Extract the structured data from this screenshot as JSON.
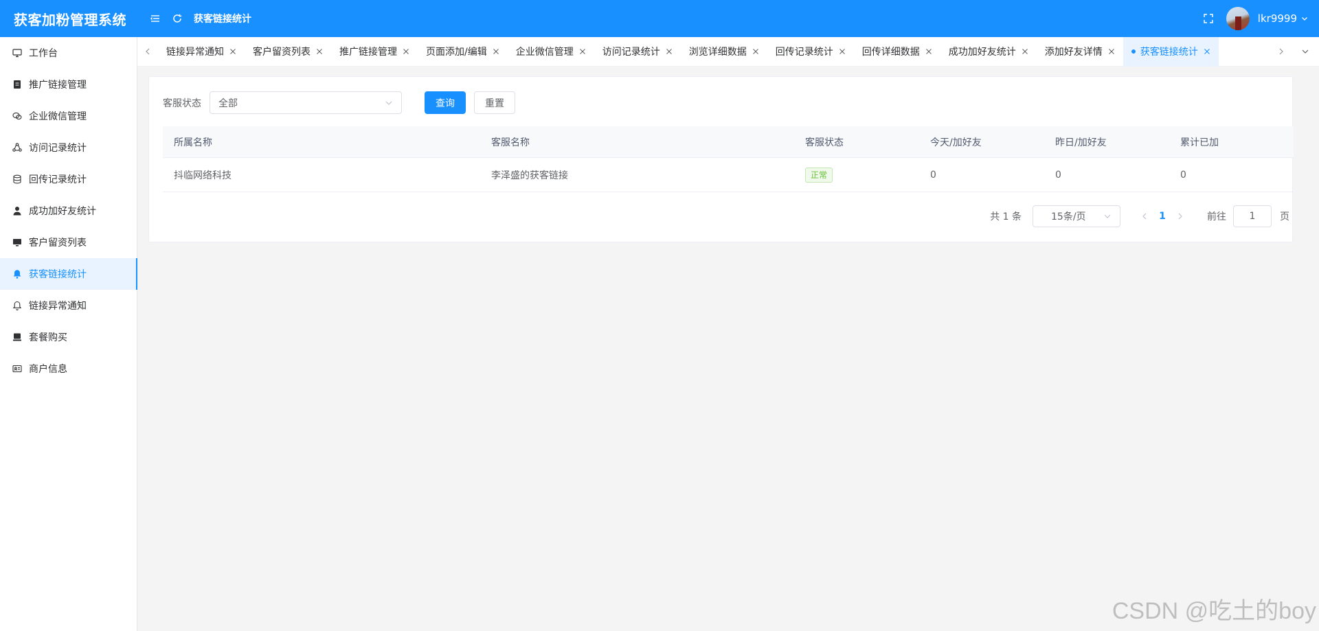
{
  "header": {
    "title": "获客加粉管理系统",
    "breadcrumb": "获客链接统计",
    "username": "lkr9999",
    "color": "#1890ff"
  },
  "sidebar": {
    "items": [
      {
        "label": "工作台",
        "icon": "monitor-icon"
      },
      {
        "label": "推广链接管理",
        "icon": "document-icon"
      },
      {
        "label": "企业微信管理",
        "icon": "wechat-icon"
      },
      {
        "label": "访问记录统计",
        "icon": "cluster-icon"
      },
      {
        "label": "回传记录统计",
        "icon": "database-icon"
      },
      {
        "label": "成功加好友统计",
        "icon": "user-icon"
      },
      {
        "label": "客户留资列表",
        "icon": "screen-icon"
      },
      {
        "label": "获客链接统计",
        "icon": "bell-filled-icon",
        "active": true
      },
      {
        "label": "链接异常通知",
        "icon": "bell-icon"
      },
      {
        "label": "套餐购买",
        "icon": "package-icon"
      },
      {
        "label": "商户信息",
        "icon": "id-card-icon"
      }
    ]
  },
  "tabs": [
    {
      "label": "链接异常通知"
    },
    {
      "label": "客户留资列表"
    },
    {
      "label": "推广链接管理"
    },
    {
      "label": "页面添加/编辑"
    },
    {
      "label": "企业微信管理"
    },
    {
      "label": "访问记录统计"
    },
    {
      "label": "浏览详细数据"
    },
    {
      "label": "回传记录统计"
    },
    {
      "label": "回传详细数据"
    },
    {
      "label": "成功加好友统计"
    },
    {
      "label": "添加好友详情"
    },
    {
      "label": "获客链接统计",
      "active": true
    }
  ],
  "filter": {
    "label": "客服状态",
    "select_value": "全部",
    "query_label": "查询",
    "reset_label": "重置"
  },
  "table": {
    "columns": [
      "所属名称",
      "客服名称",
      "客服状态",
      "今天/加好友",
      "昨日/加好友",
      "累计已加"
    ],
    "rows": [
      {
        "company": "抖临网络科技",
        "service_name": "李泽盛的获客链接",
        "status": "正常",
        "today": "0",
        "yesterday": "0",
        "total": "0"
      }
    ]
  },
  "pagination": {
    "total_text": "共 1 条",
    "page_size": "15条/页",
    "current_page": "1",
    "goto_label": "前往",
    "jump_value": "1",
    "page_unit": "页"
  },
  "watermark": "CSDN @吃土的boy"
}
